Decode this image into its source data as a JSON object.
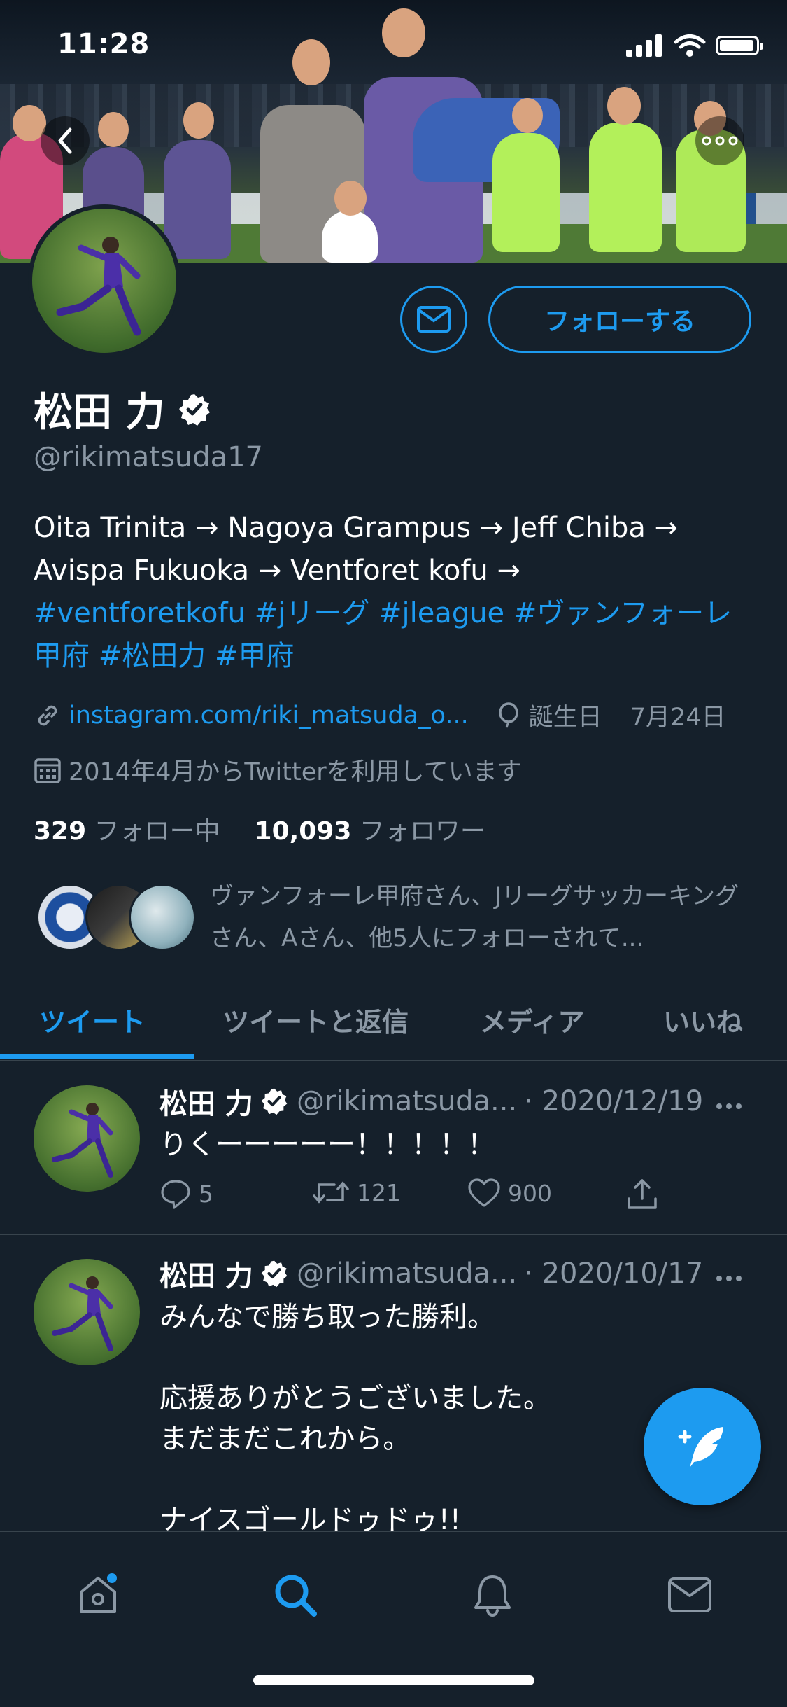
{
  "status_bar": {
    "time": "11:28"
  },
  "profile": {
    "name": "松田 力",
    "handle": "@rikimatsuda17",
    "follow_label": "フォローする",
    "bio_line1": "Oita Trinita → Nagoya Grampus → Jeff Chiba →",
    "bio_line2": "Avispa Fukuoka → Ventforet kofu →",
    "bio_tags_line3": "#ventforetkofu #jリーグ #jleague #ヴァンフォーレ",
    "bio_tags_line4": "甲府 #松田力 #甲府",
    "link": "instagram.com/riki_matsuda_o...",
    "birthday_label": "誕生日",
    "birthday": "7月24日",
    "joined": "2014年4月からTwitterを利用しています",
    "following_count": "329",
    "following_label": "フォロー中",
    "followers_count": "10,093",
    "followers_label": "フォロワー",
    "followed_by": "ヴァンフォーレ甲府さん、Jリーグサッカーキングさん、Aさん、他5人にフォローされて..."
  },
  "tabs": [
    "ツイート",
    "ツイートと返信",
    "メディア",
    "いいね"
  ],
  "tweets": [
    {
      "name": "松田 力",
      "handle": "@rikimatsuda...",
      "date": "· 2020/12/19",
      "text": "りくーーーーー！！！！！",
      "replies": "5",
      "retweets": "121",
      "likes": "900"
    },
    {
      "name": "松田 力",
      "handle": "@rikimatsuda...",
      "date": "· 2020/10/17",
      "text": "みんなで勝ち取った勝利。\n\n応援ありがとうございました。\nまだまだこれから。\n\nナイスゴールドゥドゥ!!"
    }
  ],
  "colors": {
    "accent": "#1d9bf0",
    "background": "#15202b",
    "secondary_text": "#8b98a5"
  }
}
